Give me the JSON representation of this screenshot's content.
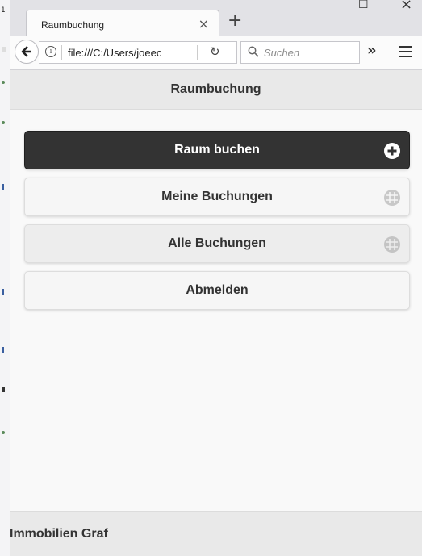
{
  "browser": {
    "tab": {
      "title": "Raumbuchung",
      "close_glyph": "×"
    },
    "new_tab_glyph": "+",
    "window_controls": {
      "maximize_glyph": "☐",
      "close_glyph": "×"
    },
    "address": {
      "info_glyph": "i",
      "url": "file:///C:/Users/joeec",
      "reload_glyph": "↻"
    },
    "search": {
      "placeholder": "Suchen"
    },
    "overflow_glyph": "»"
  },
  "app": {
    "header_title": "Raumbuchung",
    "menu": [
      {
        "label": "Raum buchen",
        "icon": "plus-icon",
        "style": "dark"
      },
      {
        "label": "Meine Buchungen",
        "icon": "grid-icon",
        "style": "light"
      },
      {
        "label": "Alle Buchungen",
        "icon": "grid-icon",
        "style": "grey"
      },
      {
        "label": "Abmelden",
        "icon": "",
        "style": "light"
      }
    ],
    "footer_text": "Immobilien Graf"
  },
  "colors": {
    "dark_button": "#333333",
    "light_button": "#f6f6f6",
    "header_bg": "#e9e9e9",
    "page_bg": "#f9f9f9"
  }
}
